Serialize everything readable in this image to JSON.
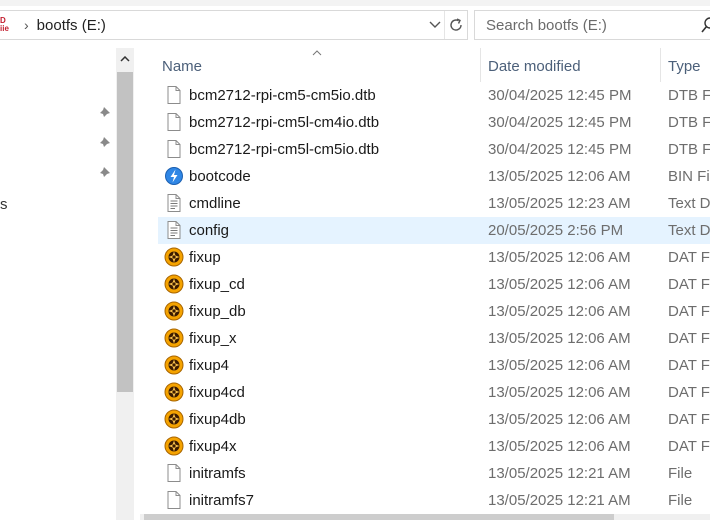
{
  "address": {
    "drive_glyph_top": "D",
    "drive_glyph_bottom": "iie",
    "path": "bootfs (E:)"
  },
  "search": {
    "placeholder": "Search bootfs (E:)"
  },
  "nav": {
    "fragment": "s",
    "pinned_count": 3
  },
  "columns": {
    "name": "Name",
    "date": "Date modified",
    "type": "Type"
  },
  "files": [
    {
      "name": "bcm2712-rpi-cm5-cm5io.dtb",
      "date": "30/04/2025 12:45 PM",
      "type": "DTB Fi",
      "icon": "blank-file-icon"
    },
    {
      "name": "bcm2712-rpi-cm5l-cm4io.dtb",
      "date": "30/04/2025 12:45 PM",
      "type": "DTB Fi",
      "icon": "blank-file-icon"
    },
    {
      "name": "bcm2712-rpi-cm5l-cm5io.dtb",
      "date": "30/04/2025 12:45 PM",
      "type": "DTB Fi",
      "icon": "blank-file-icon"
    },
    {
      "name": "bootcode",
      "date": "13/05/2025 12:06 AM",
      "type": "BIN Fi",
      "icon": "bin-file-icon"
    },
    {
      "name": "cmdline",
      "date": "13/05/2025 12:23 AM",
      "type": "Text D",
      "icon": "text-file-icon"
    },
    {
      "name": "config",
      "date": "20/05/2025 2:56 PM",
      "type": "Text D",
      "icon": "text-file-icon",
      "selected": true
    },
    {
      "name": "fixup",
      "date": "13/05/2025 12:06 AM",
      "type": "DAT Fi",
      "icon": "dat-file-icon"
    },
    {
      "name": "fixup_cd",
      "date": "13/05/2025 12:06 AM",
      "type": "DAT Fi",
      "icon": "dat-file-icon"
    },
    {
      "name": "fixup_db",
      "date": "13/05/2025 12:06 AM",
      "type": "DAT Fi",
      "icon": "dat-file-icon"
    },
    {
      "name": "fixup_x",
      "date": "13/05/2025 12:06 AM",
      "type": "DAT Fi",
      "icon": "dat-file-icon"
    },
    {
      "name": "fixup4",
      "date": "13/05/2025 12:06 AM",
      "type": "DAT Fi",
      "icon": "dat-file-icon"
    },
    {
      "name": "fixup4cd",
      "date": "13/05/2025 12:06 AM",
      "type": "DAT Fi",
      "icon": "dat-file-icon"
    },
    {
      "name": "fixup4db",
      "date": "13/05/2025 12:06 AM",
      "type": "DAT Fi",
      "icon": "dat-file-icon"
    },
    {
      "name": "fixup4x",
      "date": "13/05/2025 12:06 AM",
      "type": "DAT Fi",
      "icon": "dat-file-icon"
    },
    {
      "name": "initramfs",
      "date": "13/05/2025 12:21 AM",
      "type": "File",
      "icon": "blank-file-icon"
    },
    {
      "name": "initramfs7",
      "date": "13/05/2025 12:21 AM",
      "type": "File",
      "icon": "blank-file-icon"
    }
  ],
  "colors": {
    "selection": "#e5f3ff",
    "header_text": "#4c607a",
    "secondary_text": "#6d6d6d",
    "dat_icon": "#f5a300"
  }
}
